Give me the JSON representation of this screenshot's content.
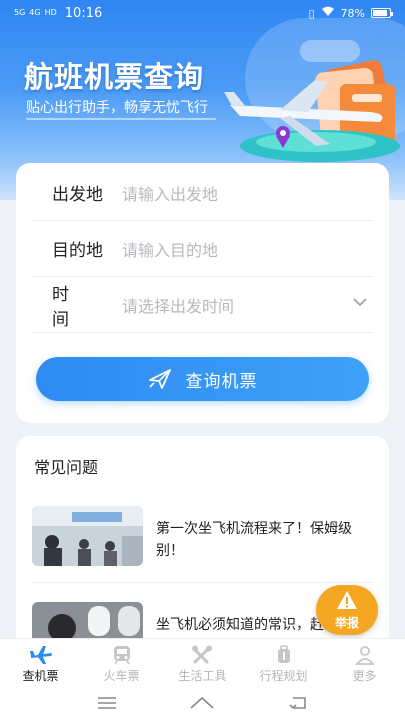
{
  "status_bar": {
    "signal_1": "5G",
    "signal_2": "4G",
    "signal_3": "HD",
    "time": "10:16",
    "battery": "78%"
  },
  "hero": {
    "title": "航班机票查询",
    "subtitle": "贴心出行助手，畅享无忧飞行"
  },
  "search_form": {
    "fields": [
      {
        "label": "出发地",
        "placeholder": "请输入出发地"
      },
      {
        "label": "目的地",
        "placeholder": "请输入目的地"
      },
      {
        "label": "时间",
        "placeholder": "请选择出发时间"
      }
    ],
    "search_button": "查询机票"
  },
  "faq": {
    "title": "常见问题",
    "items": [
      {
        "text": "第一次坐飞机流程来了！保姆级别！"
      },
      {
        "text": "坐飞机必须知道的常识，赶紧查收！"
      }
    ]
  },
  "report_button": {
    "label": "举报"
  },
  "tabbar": {
    "items": [
      {
        "label": "查机票",
        "icon": "plane-icon",
        "active": true
      },
      {
        "label": "火车票",
        "icon": "train-icon",
        "active": false
      },
      {
        "label": "生活工具",
        "icon": "tools-icon",
        "active": false
      },
      {
        "label": "行程规划",
        "icon": "luggage-icon",
        "active": false
      },
      {
        "label": "更多",
        "icon": "person-icon",
        "active": false
      }
    ]
  },
  "colors": {
    "accent": "#2e8bf2",
    "report": "#f5a623",
    "inactive": "#b3b6bb"
  }
}
